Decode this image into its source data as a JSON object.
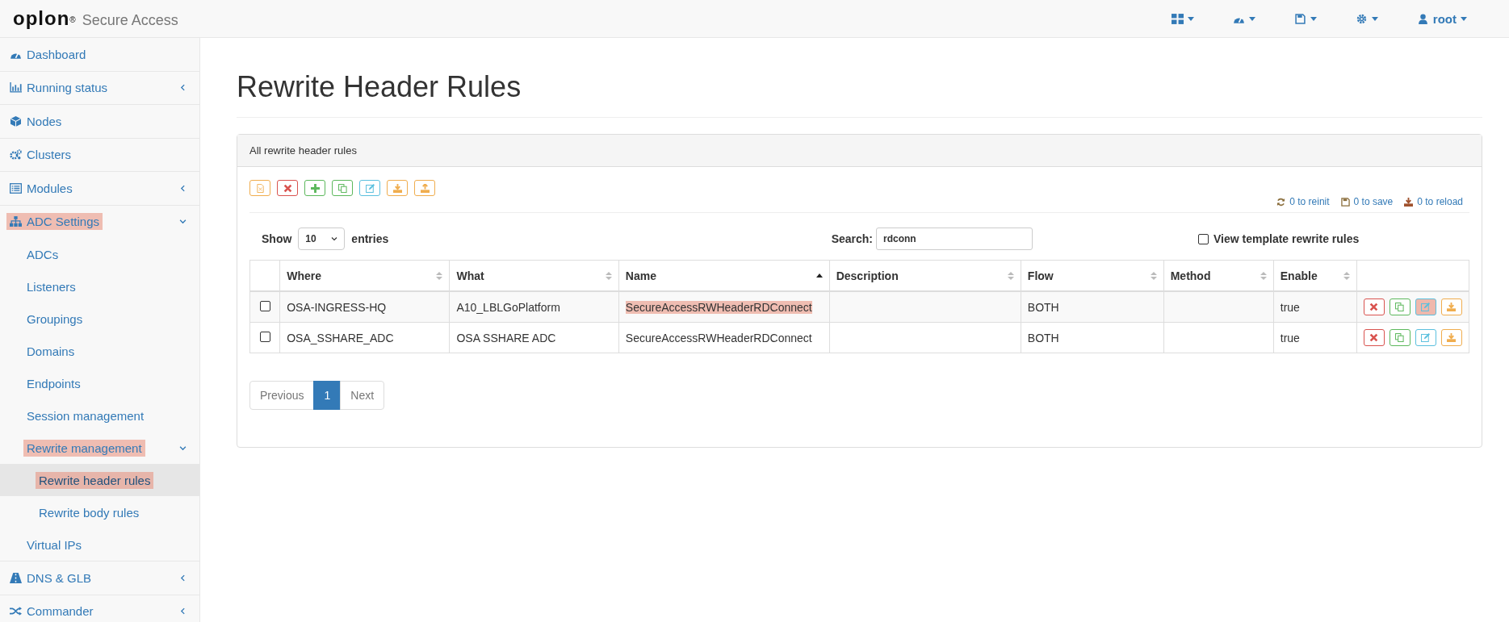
{
  "brand": {
    "logo": "oplon",
    "mark": "®",
    "product": "Secure Access"
  },
  "top_menus": [
    {
      "kind": "apps"
    },
    {
      "kind": "gauge"
    },
    {
      "kind": "save"
    },
    {
      "kind": "gear"
    },
    {
      "kind": "user",
      "label": "root"
    }
  ],
  "sidebar": {
    "items": [
      {
        "label": "Dashboard",
        "selected": false,
        "highlighted": false
      },
      {
        "label": "Running status",
        "expanded": false,
        "selected": false,
        "highlighted": false
      },
      {
        "label": "Nodes",
        "selected": false,
        "highlighted": false
      },
      {
        "label": "Clusters",
        "selected": false,
        "highlighted": false
      },
      {
        "label": "Modules",
        "expanded": false,
        "selected": false,
        "highlighted": false
      },
      {
        "label": "ADC Settings",
        "expanded": true,
        "selected": false,
        "highlighted": true,
        "children": [
          {
            "label": "ADCs",
            "selected": false,
            "highlighted": false
          },
          {
            "label": "Listeners",
            "selected": false,
            "highlighted": false
          },
          {
            "label": "Groupings",
            "selected": false,
            "highlighted": false
          },
          {
            "label": "Domains",
            "selected": false,
            "highlighted": false
          },
          {
            "label": "Endpoints",
            "selected": false,
            "highlighted": false
          },
          {
            "label": "Session management",
            "selected": false,
            "highlighted": false
          },
          {
            "label": "Rewrite management",
            "expanded": true,
            "selected": false,
            "highlighted": true,
            "children": [
              {
                "label": "Rewrite header rules",
                "selected": true,
                "highlighted": true
              },
              {
                "label": "Rewrite body rules",
                "selected": false,
                "highlighted": false
              }
            ]
          },
          {
            "label": "Virtual IPs",
            "selected": false,
            "highlighted": false
          }
        ]
      },
      {
        "label": "DNS & GLB",
        "expanded": false,
        "selected": false,
        "highlighted": false
      },
      {
        "label": "Commander",
        "expanded": false,
        "selected": false,
        "highlighted": false
      }
    ]
  },
  "page_title": "Rewrite Header Rules",
  "panel": {
    "heading": "All rewrite header rules",
    "toolbar": [
      {
        "kind": "file"
      },
      {
        "kind": "delete"
      },
      {
        "kind": "add"
      },
      {
        "kind": "copy"
      },
      {
        "kind": "edit"
      },
      {
        "kind": "download"
      },
      {
        "kind": "upload"
      }
    ],
    "counters": [
      {
        "kind": "reinit",
        "label": "0 to reinit"
      },
      {
        "kind": "save",
        "label": "0 to save"
      },
      {
        "kind": "reload",
        "label": "0 to reload"
      }
    ],
    "length": {
      "label_before": "Show",
      "value": "10",
      "label_after": "entries"
    },
    "search": {
      "label": "Search:",
      "value": "rdconn"
    },
    "template_toggle": {
      "label": "View template rewrite rules",
      "checked": false
    },
    "columns": [
      {
        "label": "Where",
        "kind": "sortable"
      },
      {
        "label": "What",
        "kind": "sortable"
      },
      {
        "label": "Name",
        "kind": "sorted"
      },
      {
        "label": "Description",
        "kind": "sortable"
      },
      {
        "label": "Flow",
        "kind": "sortable"
      },
      {
        "label": "Method",
        "kind": "sortable"
      },
      {
        "label": "Enable",
        "kind": "sortable"
      }
    ],
    "rows": [
      {
        "checked": false,
        "cells": [
          "OSA-INGRESS-HQ",
          "A10_LBLGoPlatform",
          "SecureAccessRWHeaderRDConnect",
          "",
          "BOTH",
          "",
          "true"
        ],
        "name_highlighted": true,
        "actions": [
          {
            "kind": "delete",
            "highlighted": false
          },
          {
            "kind": "copy",
            "highlighted": false
          },
          {
            "kind": "edit",
            "highlighted": true
          },
          {
            "kind": "download",
            "highlighted": false
          }
        ]
      },
      {
        "checked": false,
        "cells": [
          "OSA_SSHARE_ADC",
          "OSA SSHARE ADC",
          "SecureAccessRWHeaderRDConnect",
          "",
          "BOTH",
          "",
          "true"
        ],
        "name_highlighted": false,
        "actions": [
          {
            "kind": "delete",
            "highlighted": false
          },
          {
            "kind": "copy",
            "highlighted": false
          },
          {
            "kind": "edit",
            "highlighted": false
          },
          {
            "kind": "download",
            "highlighted": false
          }
        ]
      }
    ],
    "pagination": [
      {
        "label": "Previous",
        "selected": false
      },
      {
        "label": "1",
        "selected": true
      },
      {
        "label": "Next",
        "selected": false
      }
    ]
  }
}
